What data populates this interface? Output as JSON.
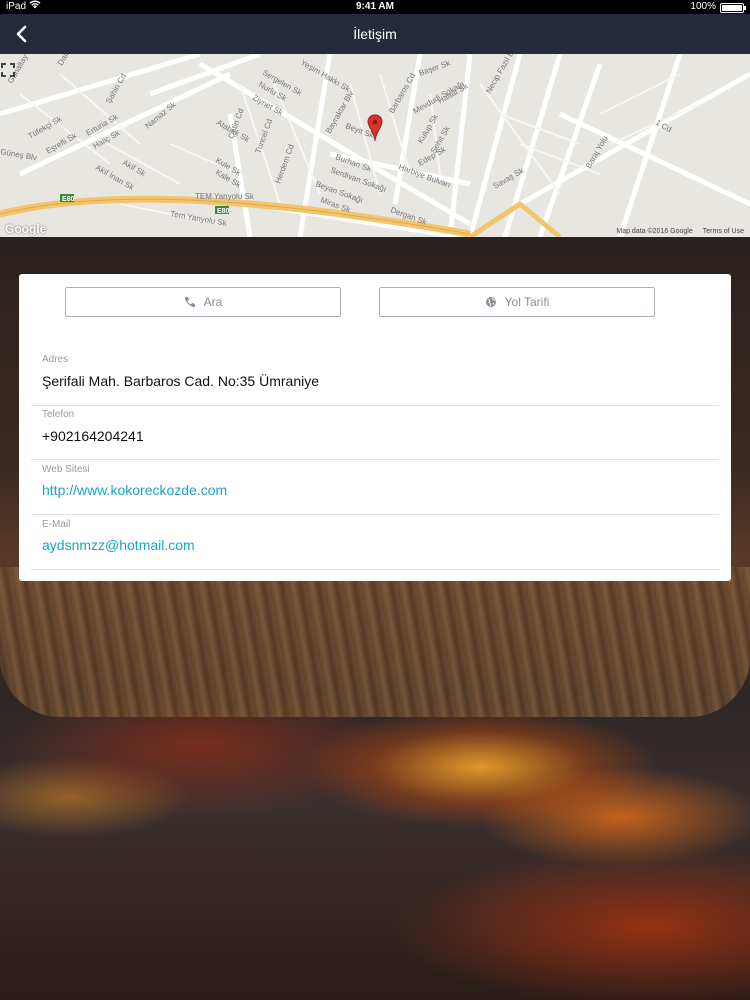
{
  "status_bar": {
    "device": "iPad",
    "time": "9:41 AM",
    "battery": "100%",
    "battery_level": 1.0
  },
  "nav": {
    "title": "İletişim",
    "back_icon": "chevron-left-icon"
  },
  "map": {
    "streets": [
      "Gunaltay Sk",
      "Şahin Cd",
      "Bayraktar Blv",
      "Barbaros Cd",
      "Başer Sk",
      "Hattat Sk",
      "Necip Fazıl Blv",
      "Mevdudi Sokağı",
      "Kulup Sk",
      "Şehit Sk",
      "Edep Sk",
      "Harbiye Bulvarı",
      "Burhan Sk",
      "Serdivan Sokağı",
      "Beyan Sokağı",
      "Miras Sk",
      "Dergah Sk",
      "TEM Yanyolu Sk",
      "Tem Yanyolu Sk",
      "Atabek Sk",
      "Tuncel Cd",
      "Herdem Cd",
      "Kule Sk",
      "Kale Sk",
      "Namaz Sk",
      "Akif Sk",
      "Akif İnan Sk",
      "Ertuna Sk",
      "Haliç Sk",
      "Tüfekçi Sk",
      "Eşrefli Sk",
      "Güneş Blv",
      "Savaş Sk",
      "Baraj Yolu",
      "1 Cd",
      "Ziynet Sk",
      "Nurlu Sk",
      "Sergelen Sk",
      "Yeşim Hakkı Sk",
      "Çetin Cd",
      "Beyit Sk"
    ],
    "highway": "E80",
    "google_label": "Google",
    "attribution": "Map data ©2016 Google",
    "terms": "Terms of Use",
    "expand_icon": "fullscreen-icon",
    "pin_icon": "map-pin-icon"
  },
  "actions": {
    "call_label": "Ara",
    "call_icon": "phone-icon",
    "route_label": "Yol Tarifi",
    "route_icon": "globe-icon"
  },
  "contact": {
    "address_label": "Adres",
    "address": "Şerifali Mah. Barbaros Cad. No:35 Ümraniye",
    "phone_label": "Telefon",
    "phone": "+902164204241",
    "web_label": "Web Sitesi",
    "web": "http://www.kokoreckozde.com",
    "email_label": "E-Mail",
    "email": "aydsnmzz@hotmail.com"
  },
  "colors": {
    "nav_bg": "#252b3a",
    "link": "#1aa3c7",
    "pin": "#d8302b"
  }
}
